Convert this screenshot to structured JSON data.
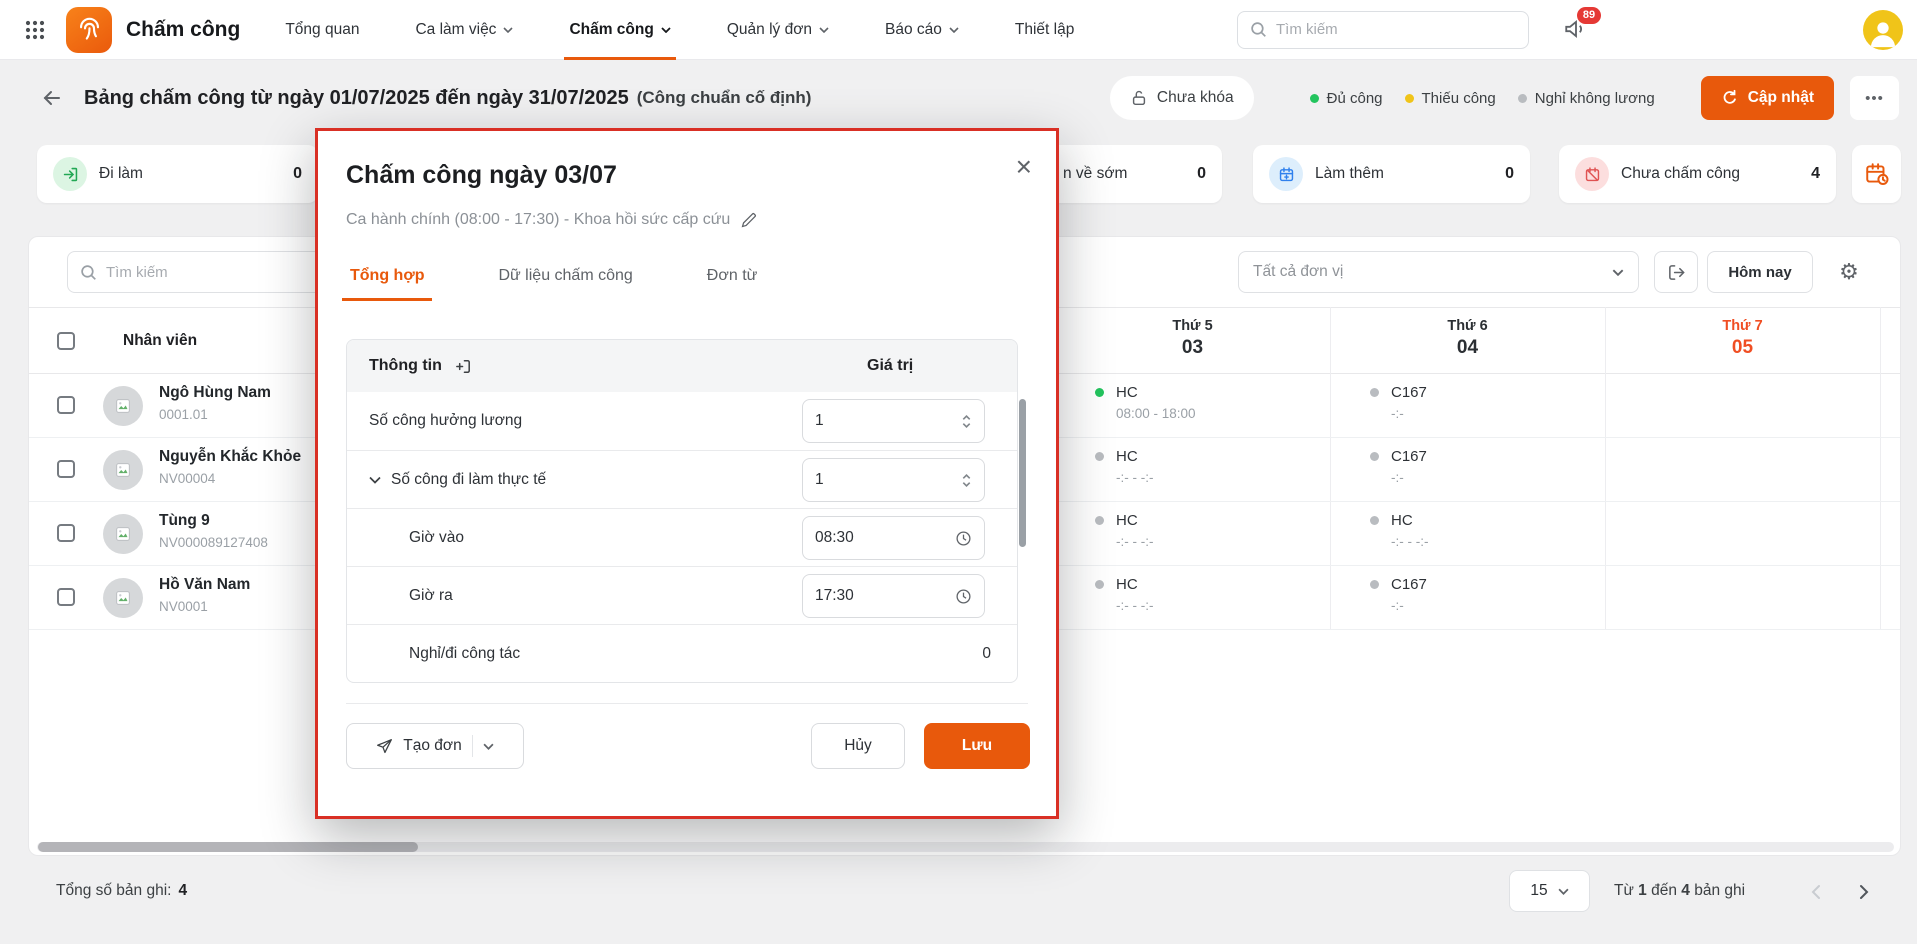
{
  "topnav": {
    "app_title": "Chấm công",
    "items": [
      {
        "label": "Tổng quan"
      },
      {
        "label": "Ca làm việc"
      },
      {
        "label": "Chấm công"
      },
      {
        "label": "Quản lý đơn"
      },
      {
        "label": "Báo cáo"
      },
      {
        "label": "Thiết lập"
      }
    ],
    "active_item": "Chấm công",
    "search_placeholder": "Tìm kiếm",
    "notification_badge": "89"
  },
  "header": {
    "title": "Bảng chấm công từ ngày 01/07/2025 đến ngày 31/07/2025",
    "title_note": "(Công chuẩn cố định)",
    "lock_pill": "Chưa khóa",
    "legend": [
      {
        "label": "Đủ công",
        "color": "#23c45e"
      },
      {
        "label": "Thiếu công",
        "color": "#f0c419"
      },
      {
        "label": "Nghỉ không lương",
        "color": "#b9bcc0"
      }
    ],
    "update_button": "Cập nhật",
    "more_button": "•••"
  },
  "stats": {
    "di_lam": {
      "label": "Đi làm",
      "value": "0"
    },
    "partial": {
      "label": "n về sớm",
      "value": "0"
    },
    "lam_them": {
      "label": "Làm thêm",
      "value": "0"
    },
    "chua_cham_cong": {
      "label": "Chưa chấm công",
      "value": "4"
    }
  },
  "toolbar": {
    "search_placeholder": "Tìm kiếm",
    "unit_filter": "Tất cả đơn vị",
    "today_button": "Hôm nay",
    "gear": "⚙"
  },
  "table": {
    "employee_header": "Nhân viên",
    "days": [
      {
        "weekday": "Thứ 5",
        "date": "03",
        "color": "#2b2f33"
      },
      {
        "weekday": "Thứ 6",
        "date": "04",
        "color": "#2b2f33"
      },
      {
        "weekday": "Thứ 7",
        "date": "05",
        "color": "#f04e23"
      }
    ],
    "employees": [
      {
        "name": "Ngô Hùng Nam",
        "code": "0001.01"
      },
      {
        "name": "Nguyễn Khắc Khỏe",
        "code": "NV00004"
      },
      {
        "name": "Tùng 9",
        "code": "NV000089127408"
      },
      {
        "name": "Hồ Văn Nam",
        "code": "NV0001"
      }
    ],
    "cells": [
      [
        {
          "code": "HC",
          "time": "08:00 - 18:00",
          "dot": "#23c45e"
        },
        {
          "code": "C167",
          "time": "-:-",
          "dot": "#b9bcc0"
        }
      ],
      [
        {
          "code": "HC",
          "time": "-:- - -:-",
          "dot": "#b9bcc0"
        },
        {
          "code": "C167",
          "time": "-:-",
          "dot": "#b9bcc0"
        }
      ],
      [
        {
          "code": "HC",
          "time": "-:- - -:-",
          "dot": "#b9bcc0"
        },
        {
          "code": "HC",
          "time": "-:- - -:-",
          "dot": "#b9bcc0"
        }
      ],
      [
        {
          "code": "HC",
          "time": "-:- - -:-",
          "dot": "#b9bcc0"
        },
        {
          "code": "C167",
          "time": "-:-",
          "dot": "#b9bcc0"
        }
      ]
    ]
  },
  "modal": {
    "title": "Chấm công ngày 03/07",
    "close": "×",
    "subtitle": "Ca hành chính (08:00 - 17:30) - Khoa hồi sức cấp cứu",
    "tabs": [
      {
        "label": "Tổng hợp"
      },
      {
        "label": "Dữ liệu chấm công"
      },
      {
        "label": "Đơn từ"
      }
    ],
    "active_tab": "Tổng hợp",
    "info_header": "Thông tin",
    "value_header": "Giá trị",
    "rows": [
      {
        "label": "Số công hưởng lương",
        "value": "1"
      },
      {
        "label": "Số công đi làm thực tế",
        "value": "1"
      },
      {
        "label": "Giờ vào",
        "value": "08:30"
      },
      {
        "label": "Giờ ra",
        "value": "17:30"
      },
      {
        "label": "Nghỉ/đi công tác",
        "value": "0"
      }
    ],
    "create_button": "Tạo đơn",
    "cancel_button": "Hủy",
    "save_button": "Lưu"
  },
  "pagination": {
    "total_label": "Tổng số bản ghi:",
    "total_value": "4",
    "page_size": "15",
    "range_pre": "Từ",
    "range_from": "1",
    "range_mid": "đến",
    "range_to": "4",
    "range_post": "bản ghi"
  }
}
